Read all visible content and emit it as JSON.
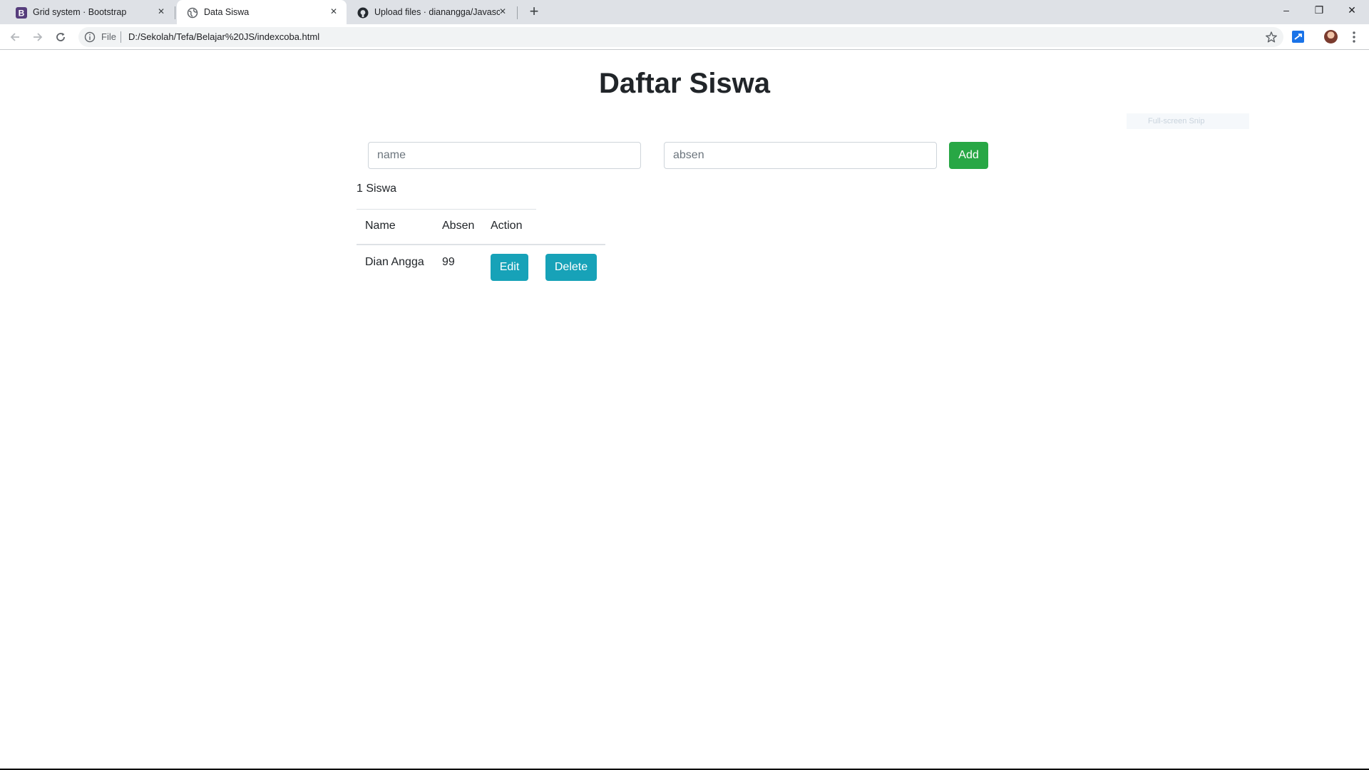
{
  "browser": {
    "tabs": [
      {
        "title": "Grid system · Bootstrap",
        "active": false,
        "icon": "bootstrap-icon"
      },
      {
        "title": "Data Siswa",
        "active": true,
        "icon": "globe-icon"
      },
      {
        "title": "Upload files · dianangga/Javascri",
        "active": false,
        "icon": "github-icon"
      }
    ],
    "close_glyph": "✕",
    "new_tab_glyph": "+",
    "window_controls": {
      "minimize": "–",
      "restore": "❐",
      "close": "✕"
    },
    "address_bar": {
      "scheme_label": "File",
      "url": "D:/Sekolah/Tefa/Belajar%20JS/indexcoba.html"
    },
    "overlay_text": "Full-screen Snip"
  },
  "page": {
    "title": "Daftar Siswa",
    "form": {
      "name_placeholder": "name",
      "name_value": "",
      "absen_placeholder": "absen",
      "absen_value": "",
      "add_label": "Add"
    },
    "count_text": "1 Siswa",
    "table": {
      "headers": [
        "Name",
        "Absen",
        "Action"
      ],
      "rows": [
        {
          "name": "Dian Angga",
          "absen": "99",
          "edit_label": "Edit",
          "delete_label": "Delete"
        }
      ]
    }
  },
  "colors": {
    "add_button": "#28a745",
    "action_button": "#17a2b8",
    "heading": "#212529"
  }
}
